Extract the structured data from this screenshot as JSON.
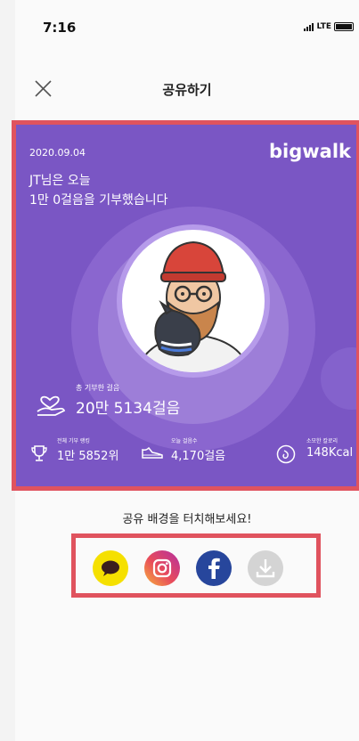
{
  "status_bar": {
    "time": "7:16",
    "network": "LTE"
  },
  "header": {
    "title": "공유하기"
  },
  "card": {
    "date": "2020.09.04",
    "logo": "bigwalk",
    "headline_line1": "JT님은 오늘",
    "headline_line2": "1만 0걸음을 기부했습니다",
    "total_donated_label": "총 기부한 걸음",
    "total_donated_value": "20만 5134걸음",
    "stats": [
      {
        "label": "전체 기부 랭킹",
        "value": "1만 5852위",
        "icon": "trophy-icon"
      },
      {
        "label": "오늘 걸음수",
        "value": "4,170걸음",
        "icon": "sneaker-icon"
      },
      {
        "label": "소모한 칼로리",
        "value": "148Kcal",
        "icon": "calorie-icon"
      }
    ]
  },
  "share": {
    "hint": "공유 배경을 터치해보세요!",
    "buttons": [
      {
        "name": "kakaotalk",
        "icon": "kakaotalk-icon",
        "color": "#f5e000"
      },
      {
        "name": "instagram",
        "icon": "instagram-icon",
        "color": "#d8367f"
      },
      {
        "name": "facebook",
        "icon": "facebook-icon",
        "color": "#27469c"
      },
      {
        "name": "download",
        "icon": "download-icon",
        "color": "#d4d4d4"
      }
    ]
  },
  "colors": {
    "card_bg": "#7a56c4",
    "highlight_border": "#e0535e"
  }
}
